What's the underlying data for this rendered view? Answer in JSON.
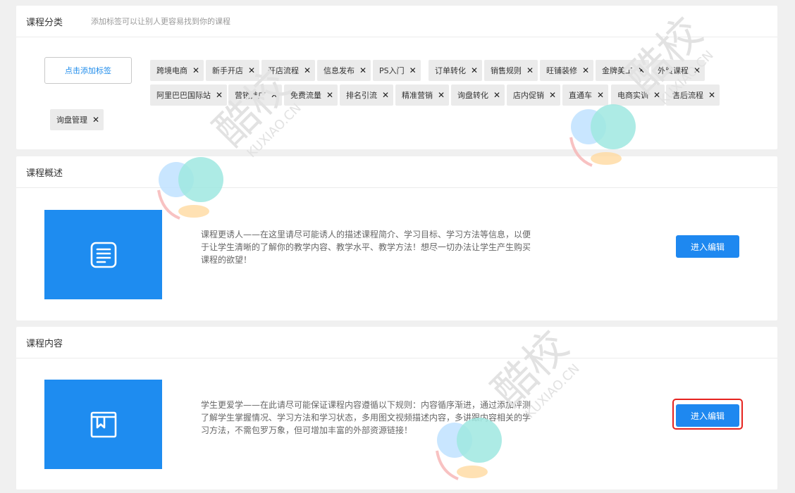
{
  "category": {
    "title": "课程分类",
    "hint": "添加标签可以让别人更容易找到你的课程",
    "add_tag_label": "点击添加标签",
    "tags": [
      "跨境电商",
      "新手开店",
      "开店流程",
      "信息发布",
      "PS入门",
      "订单转化",
      "销售规则",
      "旺铺装修",
      "金牌美工",
      "外贸课程",
      "阿里巴巴国际站",
      "营销推广",
      "免费流量",
      "排名引流",
      "精准营销",
      "询盘转化",
      "店内促销",
      "直通车",
      "电商实训",
      "售后流程",
      "询盘管理"
    ],
    "remove_glyph": "✕"
  },
  "intro": {
    "title": "课程概述",
    "desc": "课程更诱人——在这里请尽可能诱人的描述课程简介、学习目标、学习方法等信息，以便于让学生清晰的了解你的教学内容、教学水平、教学方法！想尽一切办法让学生产生购买课程的欲望！",
    "button": "进入编辑",
    "icon": "document-icon"
  },
  "content": {
    "title": "课程内容",
    "desc": "学生更爱学——在此请尽可能保证课程内容遵循以下规则：内容循序渐进，通过添加评测了解学生掌握情况、学习方法和学习状态，多用图文视频描述内容，多讲跟内容相关的学习方法，不需包罗万象，但可增加丰富的外部资源链接！",
    "button": "进入编辑",
    "icon": "book-icon"
  },
  "watermark": {
    "text": "酷校",
    "sub": "KUXIAO.CN"
  },
  "colors": {
    "accent": "#1e8cf0",
    "highlight": "#e6231f"
  }
}
